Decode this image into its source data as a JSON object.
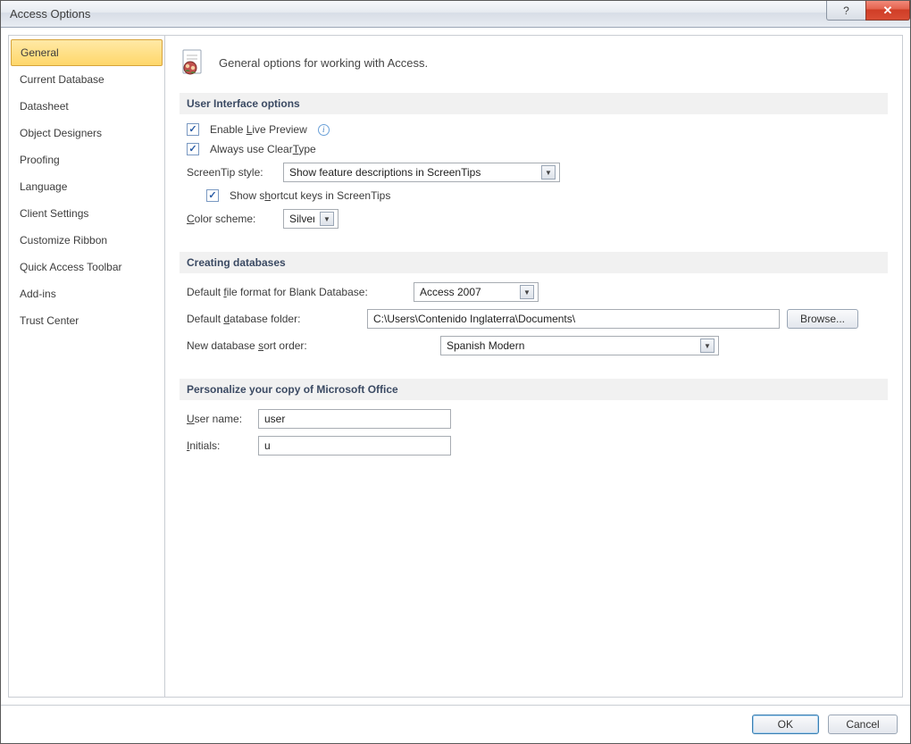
{
  "title": "Access Options",
  "sidebar": {
    "items": [
      {
        "label": "General",
        "selected": true
      },
      {
        "label": "Current Database"
      },
      {
        "label": "Datasheet"
      },
      {
        "label": "Object Designers"
      },
      {
        "label": "Proofing"
      },
      {
        "label": "Language"
      },
      {
        "label": "Client Settings"
      },
      {
        "label": "Customize Ribbon"
      },
      {
        "label": "Quick Access Toolbar"
      },
      {
        "label": "Add-ins"
      },
      {
        "label": "Trust Center"
      }
    ]
  },
  "header": {
    "text": "General options for working with Access."
  },
  "sections": {
    "ui": {
      "title": "User Interface options",
      "enable_live_preview": "Enable Live Preview",
      "always_cleartype": "Always use ClearType",
      "screentip_label": "ScreenTip style:",
      "screentip_value": "Show feature descriptions in ScreenTips",
      "show_shortcut": "Show shortcut keys in ScreenTips",
      "color_scheme_label": "Color scheme:",
      "color_scheme_value": "Silver"
    },
    "db": {
      "title": "Creating databases",
      "file_format_label": "Default file format for Blank Database:",
      "file_format_value": "Access 2007",
      "folder_label": "Default database folder:",
      "folder_value": "C:\\Users\\Contenido Inglaterra\\Documents\\",
      "browse": "Browse...",
      "sort_label": "New database sort order:",
      "sort_value": "Spanish Modern"
    },
    "personalize": {
      "title": "Personalize your copy of Microsoft Office",
      "username_label": "User name:",
      "username_value": "user",
      "initials_label": "Initials:",
      "initials_value": "u"
    }
  },
  "footer": {
    "ok": "OK",
    "cancel": "Cancel"
  }
}
